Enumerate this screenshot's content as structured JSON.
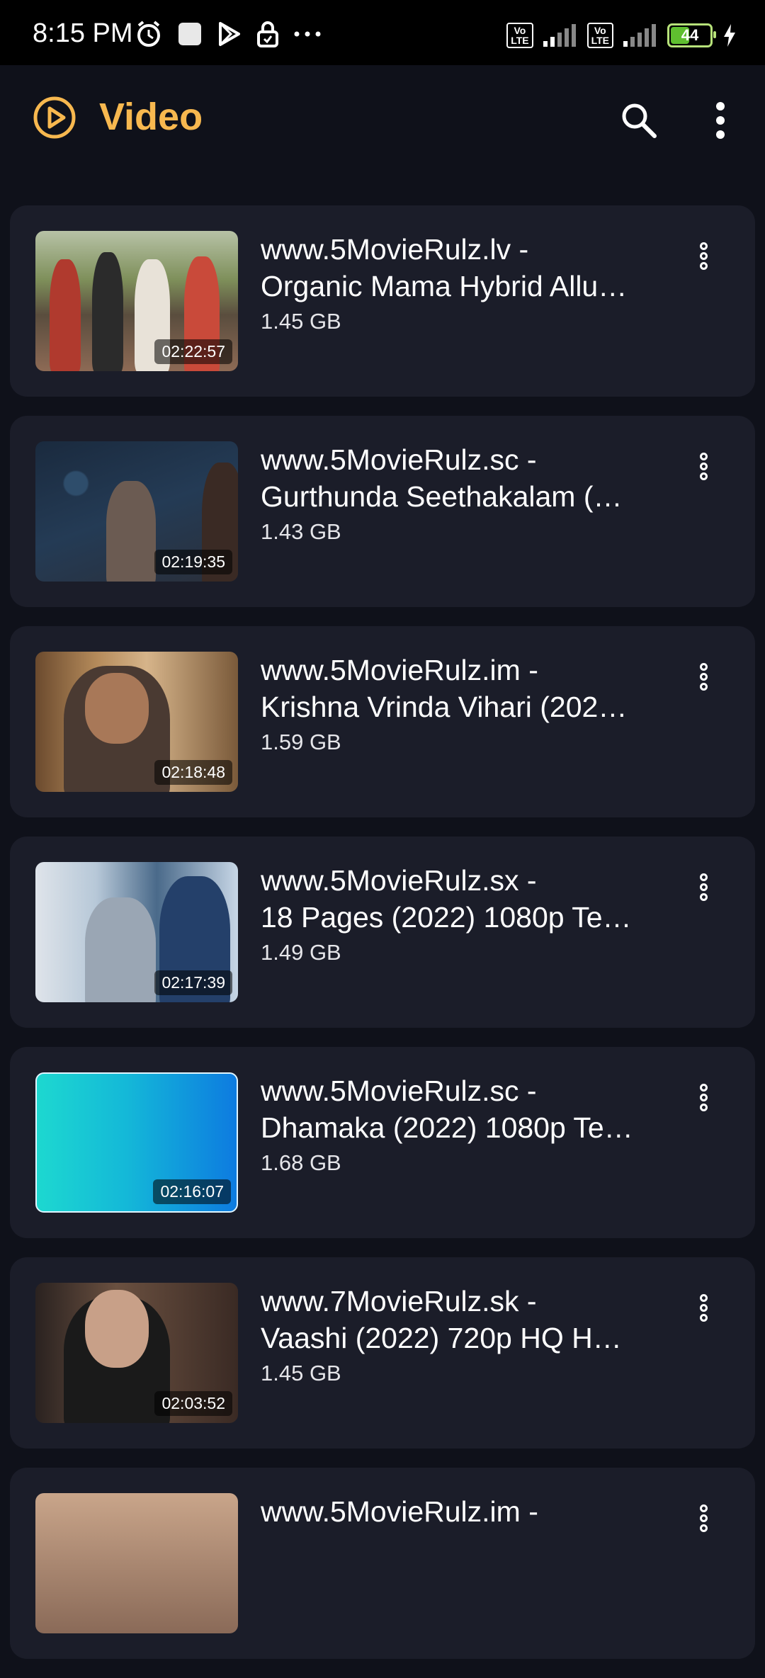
{
  "status_bar": {
    "time": "8:15 PM",
    "battery": "44"
  },
  "app_bar": {
    "title": "Video",
    "title_color": "#f7b84f"
  },
  "videos": [
    {
      "title_line1": "www.5MovieRulz.lv -",
      "title_line2": "Organic Mama Hybrid Allu…",
      "size": "1.45 GB",
      "duration": "02:22:57"
    },
    {
      "title_line1": "www.5MovieRulz.sc -",
      "title_line2": "Gurthunda Seethakalam (…",
      "size": "1.43 GB",
      "duration": "02:19:35"
    },
    {
      "title_line1": "www.5MovieRulz.im -",
      "title_line2": "Krishna Vrinda Vihari (202…",
      "size": "1.59 GB",
      "duration": "02:18:48"
    },
    {
      "title_line1": "www.5MovieRulz.sx -",
      "title_line2": "18 Pages (2022) 1080p Te…",
      "size": "1.49 GB",
      "duration": "02:17:39"
    },
    {
      "title_line1": "www.5MovieRulz.sc -",
      "title_line2": "Dhamaka (2022) 1080p Te…",
      "size": "1.68 GB",
      "duration": "02:16:07"
    },
    {
      "title_line1": "www.7MovieRulz.sk -",
      "title_line2": "Vaashi (2022) 720p HQ H…",
      "size": "1.45 GB",
      "duration": "02:03:52"
    },
    {
      "title_line1": "www.5MovieRulz.im -",
      "title_line2": "",
      "size": "",
      "duration": ""
    }
  ]
}
